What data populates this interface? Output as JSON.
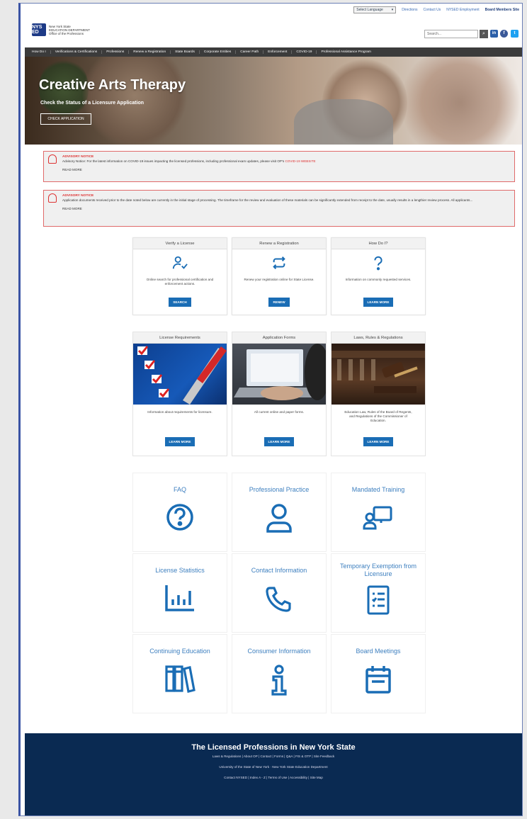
{
  "topbar": {
    "language": "Select Language",
    "links": [
      "Directions",
      "Contact Us",
      "NYSED Employment"
    ],
    "board_link": "Board Members Site"
  },
  "header": {
    "logo_text": [
      "New York State",
      "EDUCATION DEPARTMENT",
      "Office of the Professions"
    ],
    "logo_mark": "NYS ED",
    "search_placeholder": "Search...",
    "social": [
      "in",
      "f",
      "t"
    ]
  },
  "nav": [
    "How Do I",
    "Verifications & Certifications",
    "Professions",
    "Renew a Registration",
    "State Boards",
    "Corporate Entities",
    "Career Path",
    "Enforcement",
    "COVID-19",
    "Professional Assistance Program"
  ],
  "hero": {
    "title": "Creative Arts Therapy",
    "subtitle": "Check the Status of a Licensure Application",
    "button": "CHECK APPLICATION"
  },
  "notices": [
    {
      "title": "ADVISORY NOTICE",
      "body": "Advisory Notice: For the latest information on COVID-19 issues impacting the licensed professions, including professional exam updates, please visit OP's",
      "link": "COVID-19 WEBSITE",
      "more": "READ MORE"
    },
    {
      "title": "ADVISORY NOTICE",
      "body": "Application documents received prior to the date noted below are currently in the initial stage of processing. The timeframe for the review and evaluation of these materials can be significantly extended from receipt to the date, usually results in a lengthier review process. All applicants...",
      "link": "",
      "more": "READ MORE"
    }
  ],
  "action_cards": [
    {
      "title": "Verify a License",
      "desc": "Online search for professional certification and enforcement actions.",
      "button": "SEARCH",
      "icon": "user-check-icon"
    },
    {
      "title": "Renew a Registration",
      "desc": "Renew your registration online for State License.",
      "button": "RENEW",
      "icon": "renew-arrows-icon"
    },
    {
      "title": "How Do I?",
      "desc": "Information on commonly requested services.",
      "button": "LEARN MORE",
      "icon": "question-icon"
    }
  ],
  "photo_cards": [
    {
      "title": "License Requirements",
      "desc": "Information about requirements for licensure.",
      "button": "LEARN MORE"
    },
    {
      "title": "Application Forms",
      "desc": "All current online and paper forms.",
      "button": "LEARN MORE"
    },
    {
      "title": "Laws, Rules & Regulations",
      "desc": "Education Law, Rules of the Board of Regents, and Regulations of the Commissioner of Education.",
      "button": "LEARN MORE"
    }
  ],
  "tiles": [
    {
      "label": "FAQ",
      "icon": "faq-icon"
    },
    {
      "label": "Professional Practice",
      "icon": "person-icon"
    },
    {
      "label": "Mandated Training",
      "icon": "training-icon"
    },
    {
      "label": "License Statistics",
      "icon": "bar-chart-icon"
    },
    {
      "label": "Contact Information",
      "icon": "phone-icon"
    },
    {
      "label": "Temporary Exemption from Licensure",
      "icon": "checklist-icon"
    },
    {
      "label": "Continuing Education",
      "icon": "books-icon"
    },
    {
      "label": "Consumer Information",
      "icon": "info-icon"
    },
    {
      "label": "Board Meetings",
      "icon": "calendar-icon"
    }
  ],
  "footer": {
    "title": "The Licensed Professions in New York State",
    "links1": "Laws & Regulations | About OP | Contact | Forms | Q&A | FIS & OTP | Site Feedback",
    "links2": "University of the State of New York · New York State Education Department",
    "links3": "Contact NYSED | Index A - Z | Terms of Use | Accessibility | Site Map"
  },
  "colors": {
    "accent": "#1a6db5",
    "footer": "#0a2a52",
    "notice": "#d33333",
    "icon_blue": "#1a6db5"
  }
}
